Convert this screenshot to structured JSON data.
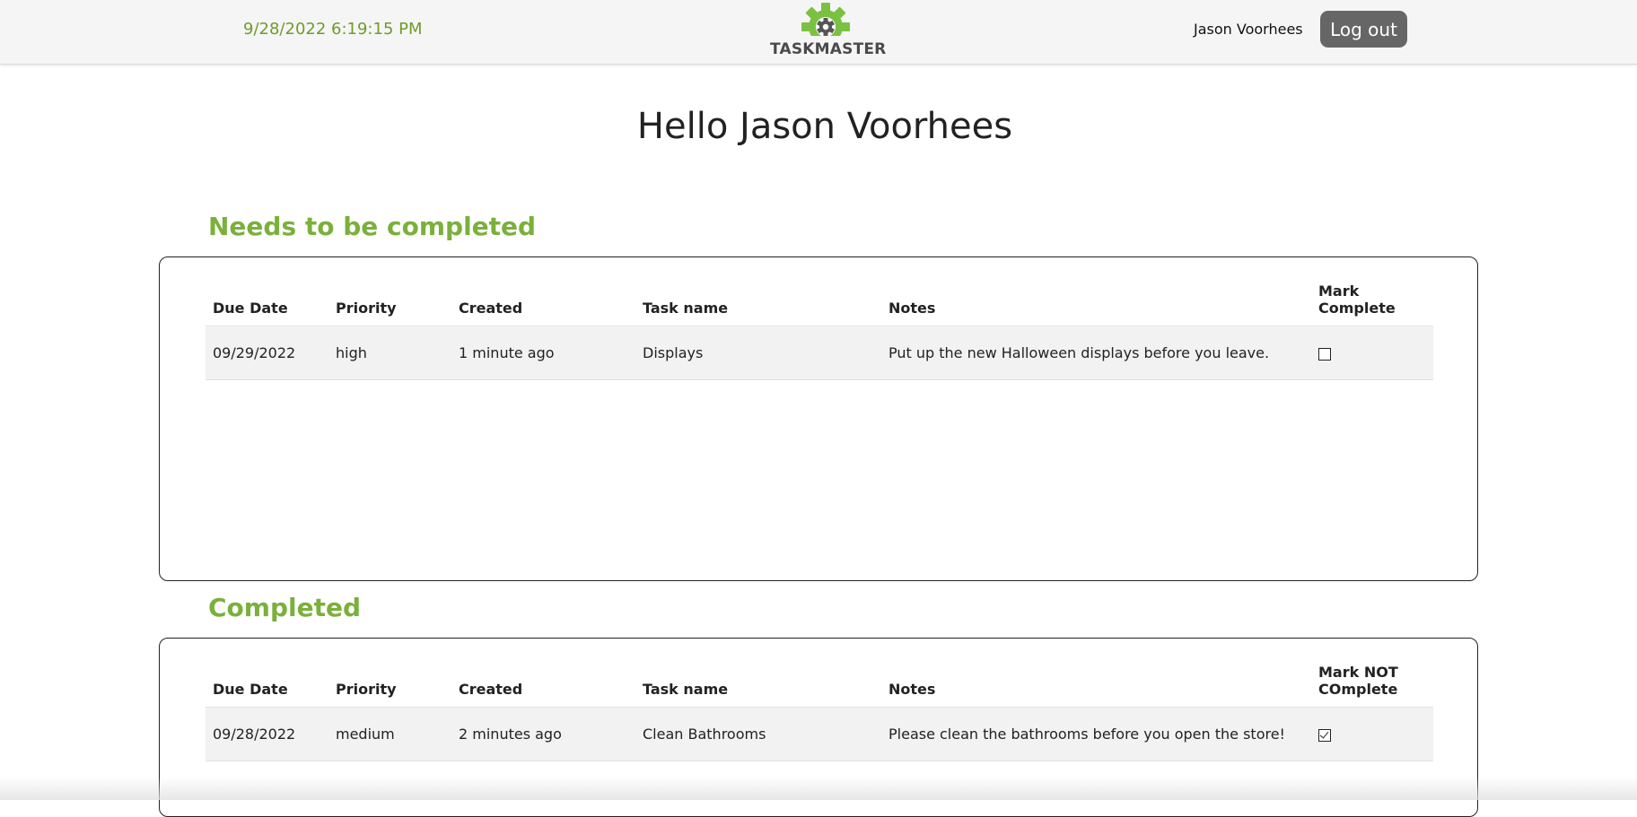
{
  "header": {
    "datetime": "9/28/2022 6:19:15 PM",
    "logo_text": "TASKMASTER",
    "user_name": "Jason Voorhees",
    "logout_label": "Log out"
  },
  "greeting": "Hello Jason Voorhees",
  "incomplete": {
    "title": "Needs to be completed",
    "columns": [
      "Due Date",
      "Priority",
      "Created",
      "Task name",
      "Notes",
      "Mark Complete"
    ],
    "rows": [
      {
        "due_date": "09/29/2022",
        "priority": "high",
        "created": "1 minute ago",
        "task_name": "Displays",
        "notes": "Put up the new Halloween displays before you leave.",
        "checked": false
      }
    ]
  },
  "completed": {
    "title": "Completed",
    "columns": [
      "Due Date",
      "Priority",
      "Created",
      "Task name",
      "Notes",
      "Mark NOT COmplete"
    ],
    "rows": [
      {
        "due_date": "09/28/2022",
        "priority": "medium",
        "created": "2 minutes ago",
        "task_name": "Clean Bathrooms",
        "notes": "Please clean the bathrooms before you open the store!",
        "checked": true
      }
    ]
  },
  "colors": {
    "accent_green": "#7ab03b",
    "datetime_green": "#6f9b2a",
    "logout_bg": "#666666"
  },
  "icons": {
    "logo": "gear-icon",
    "unchecked": "checkbox-unchecked-icon",
    "checked": "checkbox-checked-icon"
  }
}
